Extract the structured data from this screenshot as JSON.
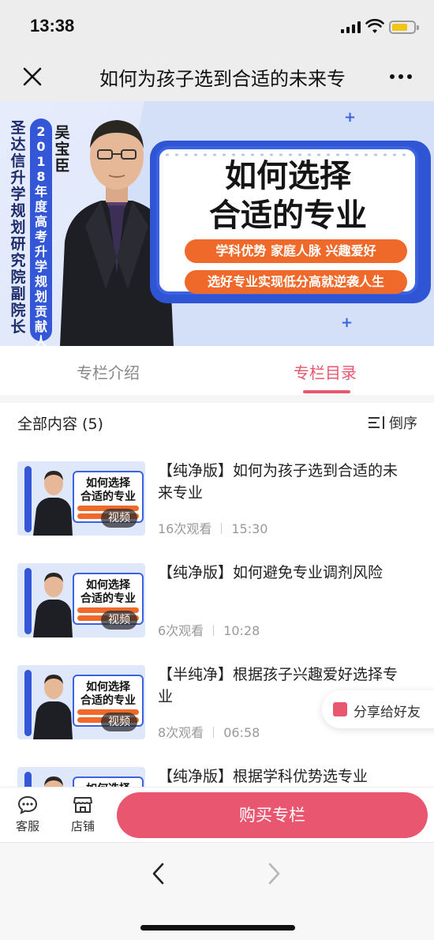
{
  "status_bar": {
    "time": "13:38"
  },
  "nav": {
    "title": "如何为孩子选到合适的未来专业"
  },
  "banner": {
    "speaker_name": "吴宝臣",
    "speaker_honor": "2018年度高考升学规划贡献人物",
    "speaker_org": "圣达信升学规划研究院副院长",
    "headline_line1": "如何选择",
    "headline_line2": "合适的专业",
    "tags": "学科优势  家庭人脉  兴趣爱好",
    "slogan": "选好专业实现低分高就逆袭人生"
  },
  "tabs": [
    {
      "label": "专栏介绍",
      "active": false
    },
    {
      "label": "专栏目录",
      "active": true
    }
  ],
  "list": {
    "header": "全部内容 (5)",
    "sort_label": "倒序",
    "items": [
      {
        "title": "【纯净版】如何为孩子选到合适的未来专业",
        "badge": "视频",
        "views": "16次观看",
        "duration": "15:30"
      },
      {
        "title": "【纯净版】如何避免专业调剂风险",
        "badge": "视频",
        "views": "6次观看",
        "duration": "10:28"
      },
      {
        "title": "【半纯净】根据孩子兴趣爱好选择专业",
        "badge": "视频",
        "views": "8次观看",
        "duration": "06:58"
      },
      {
        "title": "【纯净版】根据学科优势选专业",
        "badge": "",
        "views": "",
        "duration": ""
      }
    ],
    "thumb_title": "如何选择\n合适的专业"
  },
  "share": {
    "label": "分享给好友"
  },
  "actions": {
    "service_label": "客服",
    "shop_label": "店铺",
    "buy_label": "购买专栏"
  },
  "colors": {
    "accent": "#e8576f",
    "banner_blue": "#3357d6",
    "banner_orange": "#ef6a2a"
  }
}
